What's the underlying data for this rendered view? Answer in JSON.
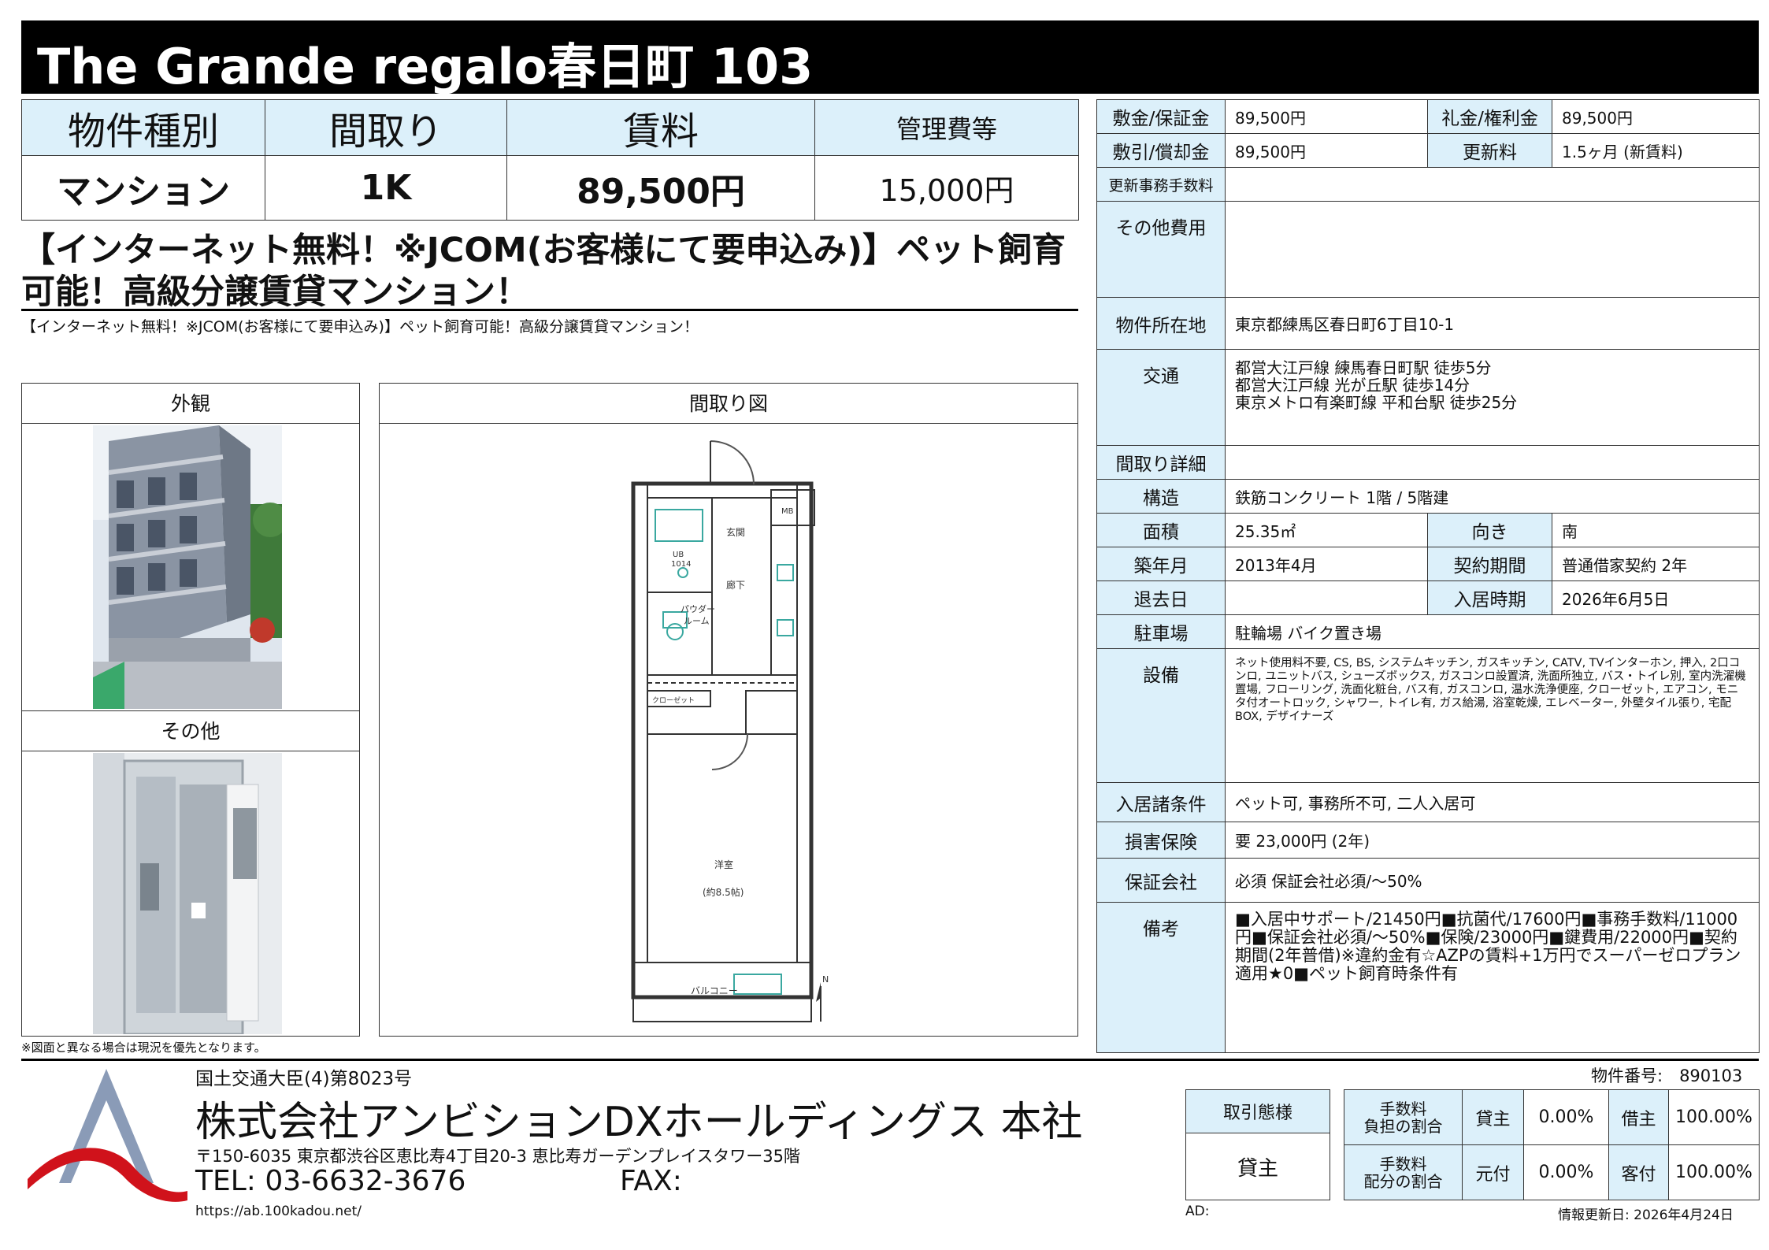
{
  "title": "The Grande regalo春日町 103",
  "summary": {
    "headers": [
      "物件種別",
      "間取り",
      "賃料",
      "管理費等"
    ],
    "values": [
      "マンション",
      "1K",
      "89,500円",
      "15,000円"
    ]
  },
  "catch_copy": "【インターネット無料！※JCOM(お客様にて要申込み)】ペット飼育可能！高級分譲賃貸マンション！",
  "sub_copy": "【インターネット無料！※JCOM(お客様にて要申込み)】ペット飼育可能！高級分譲賃貸マンション！",
  "panels": {
    "exterior": "外観",
    "other": "その他",
    "floorplan": "間取り図"
  },
  "floorplan_labels": {
    "entrance": "玄関",
    "mb": "MB",
    "ub": "UB",
    "ub_no": "1014",
    "hallway": "廊下",
    "powder_room_1": "パウダー",
    "powder_room_2": "ルーム",
    "closet": "クローゼット",
    "western_room": "洋室",
    "size": "(約8.5帖)",
    "balcony": "バルコニー",
    "north": "N"
  },
  "details": {
    "deposit_label": "敷金/保証金",
    "deposit": "89,500円",
    "key_money_label": "礼金/権利金",
    "key_money": "89,500円",
    "amortization_label": "敷引/償却金",
    "amortization": "89,500円",
    "renewal_fee_label": "更新料",
    "renewal_fee": "1.5ヶ月 (新賃料)",
    "renewal_admin_label": "更新事務手数料",
    "renewal_admin": "",
    "other_costs_label": "その他費用",
    "other_costs": "",
    "location_label": "物件所在地",
    "location": "東京都練馬区春日町6丁目10-1",
    "transport_label": "交通",
    "transport": [
      "都営大江戸線 練馬春日町駅 徒歩5分",
      "都営大江戸線 光が丘駅 徒歩14分",
      "東京メトロ有楽町線 平和台駅 徒歩25分"
    ],
    "layout_detail_label": "間取り詳細",
    "layout_detail": "",
    "structure_label": "構造",
    "structure": "鉄筋コンクリート 1階 / 5階建",
    "area_label": "面積",
    "area": "25.35㎡",
    "direction_label": "向き",
    "direction": "南",
    "built_label": "築年月",
    "built": "2013年4月",
    "contract_label": "契約期間",
    "contract": "普通借家契約 2年",
    "vacate_label": "退去日",
    "vacate": "",
    "move_in_label": "入居時期",
    "move_in": "2026年6月5日",
    "parking_label": "駐車場",
    "parking": "駐輪場 バイク置き場",
    "equipment_label": "設備",
    "equipment": "ネット使用料不要, CS, BS, システムキッチン, ガスキッチン, CATV, TVインターホン, 押入, 2口コンロ, ユニットバス, シューズボックス, ガスコンロ設置済, 洗面所独立, バス・トイレ別, 室内洗濯機置場, フローリング, 洗面化粧台, バス有, ガスコンロ, 温水洗浄便座, クローゼット, エアコン, モニタ付オートロック, シャワー, トイレ有, ガス給湯, 浴室乾燥, エレベーター, 外壁タイル張り, 宅配BOX, デザイナーズ",
    "conditions_label": "入居諸条件",
    "conditions": "ペット可, 事務所不可, 二人入居可",
    "insurance_label": "損害保険",
    "insurance": "要 23,000円 (2年)",
    "guarantor_label": "保証会社",
    "guarantor": "必須 保証会社必須/〜50%",
    "remarks_label": "備考",
    "remarks": "■入居中サポート/21450円■抗菌代/17600円■事務手数料/11000円■保証会社必須/〜50%■保険/23000円■鍵費用/22000円■契約期間(2年普借)※違約金有☆AZPの賃料+1万円でスーパーゼロプラン適用★0■ペット飼育時条件有"
  },
  "note": "※図面と異なる場合は現況を優先となります。",
  "company": {
    "license": "国土交通大臣(4)第8023号",
    "name": "株式会社アンビションDXホールディングス 本社",
    "address": "〒150-6035 東京都渋谷区恵比寿4丁目20-3 恵比寿ガーデンプレイスタワー35階",
    "tel": "TEL: 03-6632-3676",
    "fax": "FAX:",
    "url": "https://ab.100kadou.net/"
  },
  "property_number": "物件番号:　890103",
  "transaction": {
    "type_label": "取引態様",
    "type_value": "貸主",
    "fee_burden_label": "手数料\n負担の割合",
    "fee_split_label": "手数料\n配分の割合",
    "landlord": "貸主",
    "landlord_pct": "0.00%",
    "tenant": "借主",
    "tenant_pct": "100.00%",
    "origin": "元付",
    "origin_pct": "0.00%",
    "agent": "客付",
    "agent_pct": "100.00%"
  },
  "ad": "AD:",
  "updated": "情報更新日: 2026年4月24日",
  "colors": {
    "header_bg": "#dcf0fa",
    "title_bg": "#000000",
    "logo_red": "#d0121b",
    "logo_blue": "#8a9bb7"
  }
}
